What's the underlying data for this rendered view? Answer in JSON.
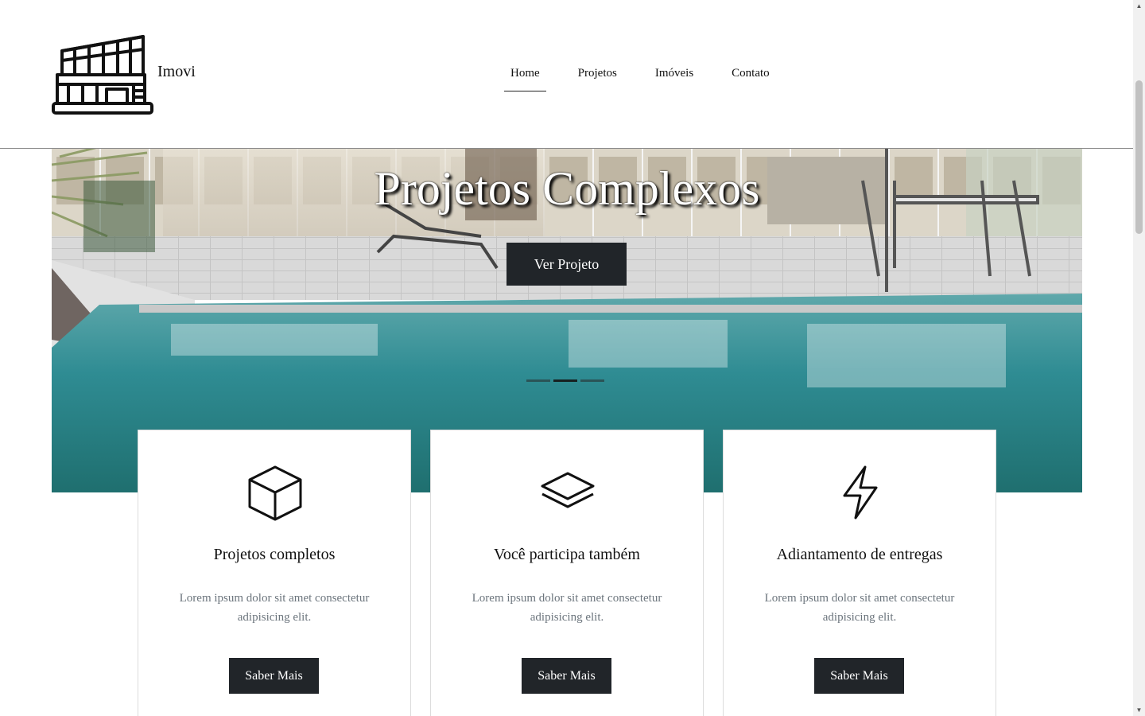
{
  "header": {
    "brand": "Imovi",
    "logo_icon": "building-logo-icon"
  },
  "nav": {
    "items": [
      {
        "label": "Home",
        "active": true
      },
      {
        "label": "Projetos",
        "active": false
      },
      {
        "label": "Imóveis",
        "active": false
      },
      {
        "label": "Contato",
        "active": false
      }
    ]
  },
  "hero": {
    "title": "Projetos Complexos",
    "button_label": "Ver Projeto",
    "image": "pool-terrace-photo",
    "slides": 3,
    "active_slide": 1
  },
  "cards": [
    {
      "icon": "cube-icon",
      "title": "Projetos completos",
      "text": "Lorem ipsum dolor sit amet consectetur adipisicing elit.",
      "button_label": "Saber Mais"
    },
    {
      "icon": "layers-icon",
      "title": "Você participa também",
      "text": "Lorem ipsum dolor sit amet consectetur adipisicing elit.",
      "button_label": "Saber Mais"
    },
    {
      "icon": "lightning-icon",
      "title": "Adiantamento de entregas",
      "text": "Lorem ipsum dolor sit amet consectetur adipisicing elit.",
      "button_label": "Saber Mais"
    }
  ],
  "colors": {
    "button_bg": "#212529",
    "button_text": "#ffffff",
    "muted_text": "#6c757d",
    "pool_water": "#2f8c93"
  }
}
